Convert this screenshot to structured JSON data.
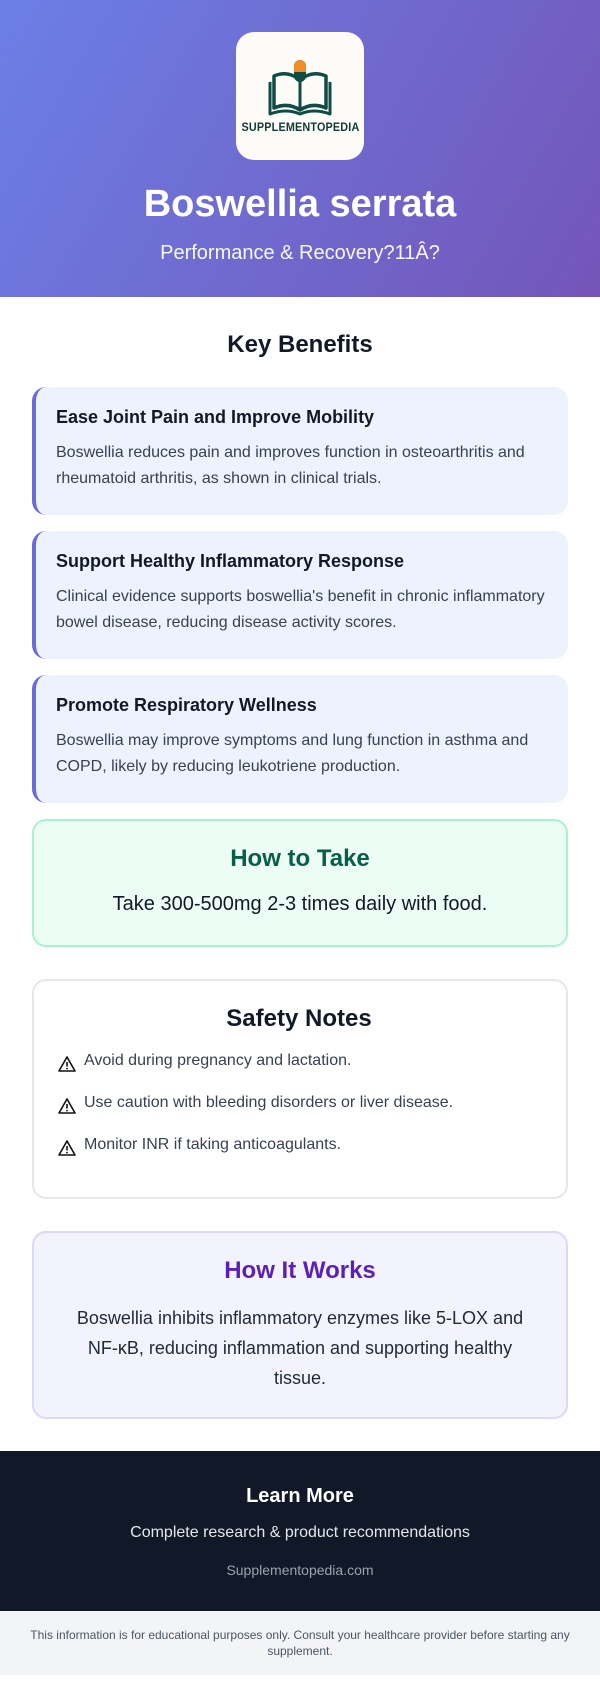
{
  "header": {
    "logo_text": "SUPPLEMENTOPEDIA",
    "title": "Boswellia serrata",
    "subtitle": "Performance & Recovery?11Â\u0001?"
  },
  "benefits": {
    "heading": "Key Benefits",
    "items": [
      {
        "title": "Ease Joint Pain and Improve Mobility",
        "text": "Boswellia reduces pain and improves function in osteoarthritis and rheumatoid arthritis, as shown in clinical trials."
      },
      {
        "title": "Support Healthy Inflammatory Response",
        "text": "Clinical evidence supports boswellia's benefit in chronic inflammatory bowel disease, reducing disease activity scores."
      },
      {
        "title": "Promote Respiratory Wellness",
        "text": "Boswellia may improve symptoms and lung function in asthma and COPD, likely by reducing leukotriene production."
      }
    ]
  },
  "how_to_take": {
    "heading": "How to Take",
    "text": "Take 300-500mg 2-3 times daily with food."
  },
  "safety": {
    "heading": "Safety Notes",
    "icon": "warning-icon",
    "items": [
      "Avoid during pregnancy and lactation.",
      "Use caution with bleeding disorders or liver disease.",
      "Monitor INR if taking anticoagulants."
    ]
  },
  "how_it_works": {
    "heading": "How It Works",
    "text": "Boswellia inhibits inflammatory enzymes like 5-LOX and NF-κB, reducing inflammation and supporting healthy tissue."
  },
  "footer": {
    "title": "Learn More",
    "subtitle": "Complete research & product recommendations",
    "link": "Supplementopedia.com"
  },
  "disclaimer": "This information is for educational purposes only. Consult your healthcare provider before starting any supplement.",
  "colors": {
    "header_gradient_start": "#6b7fe6",
    "header_gradient_end": "#7455b8",
    "accent_green": "#065f46",
    "accent_purple": "#5b21b6",
    "logo_orange": "#f28c28",
    "logo_teal": "#0f4c45"
  }
}
